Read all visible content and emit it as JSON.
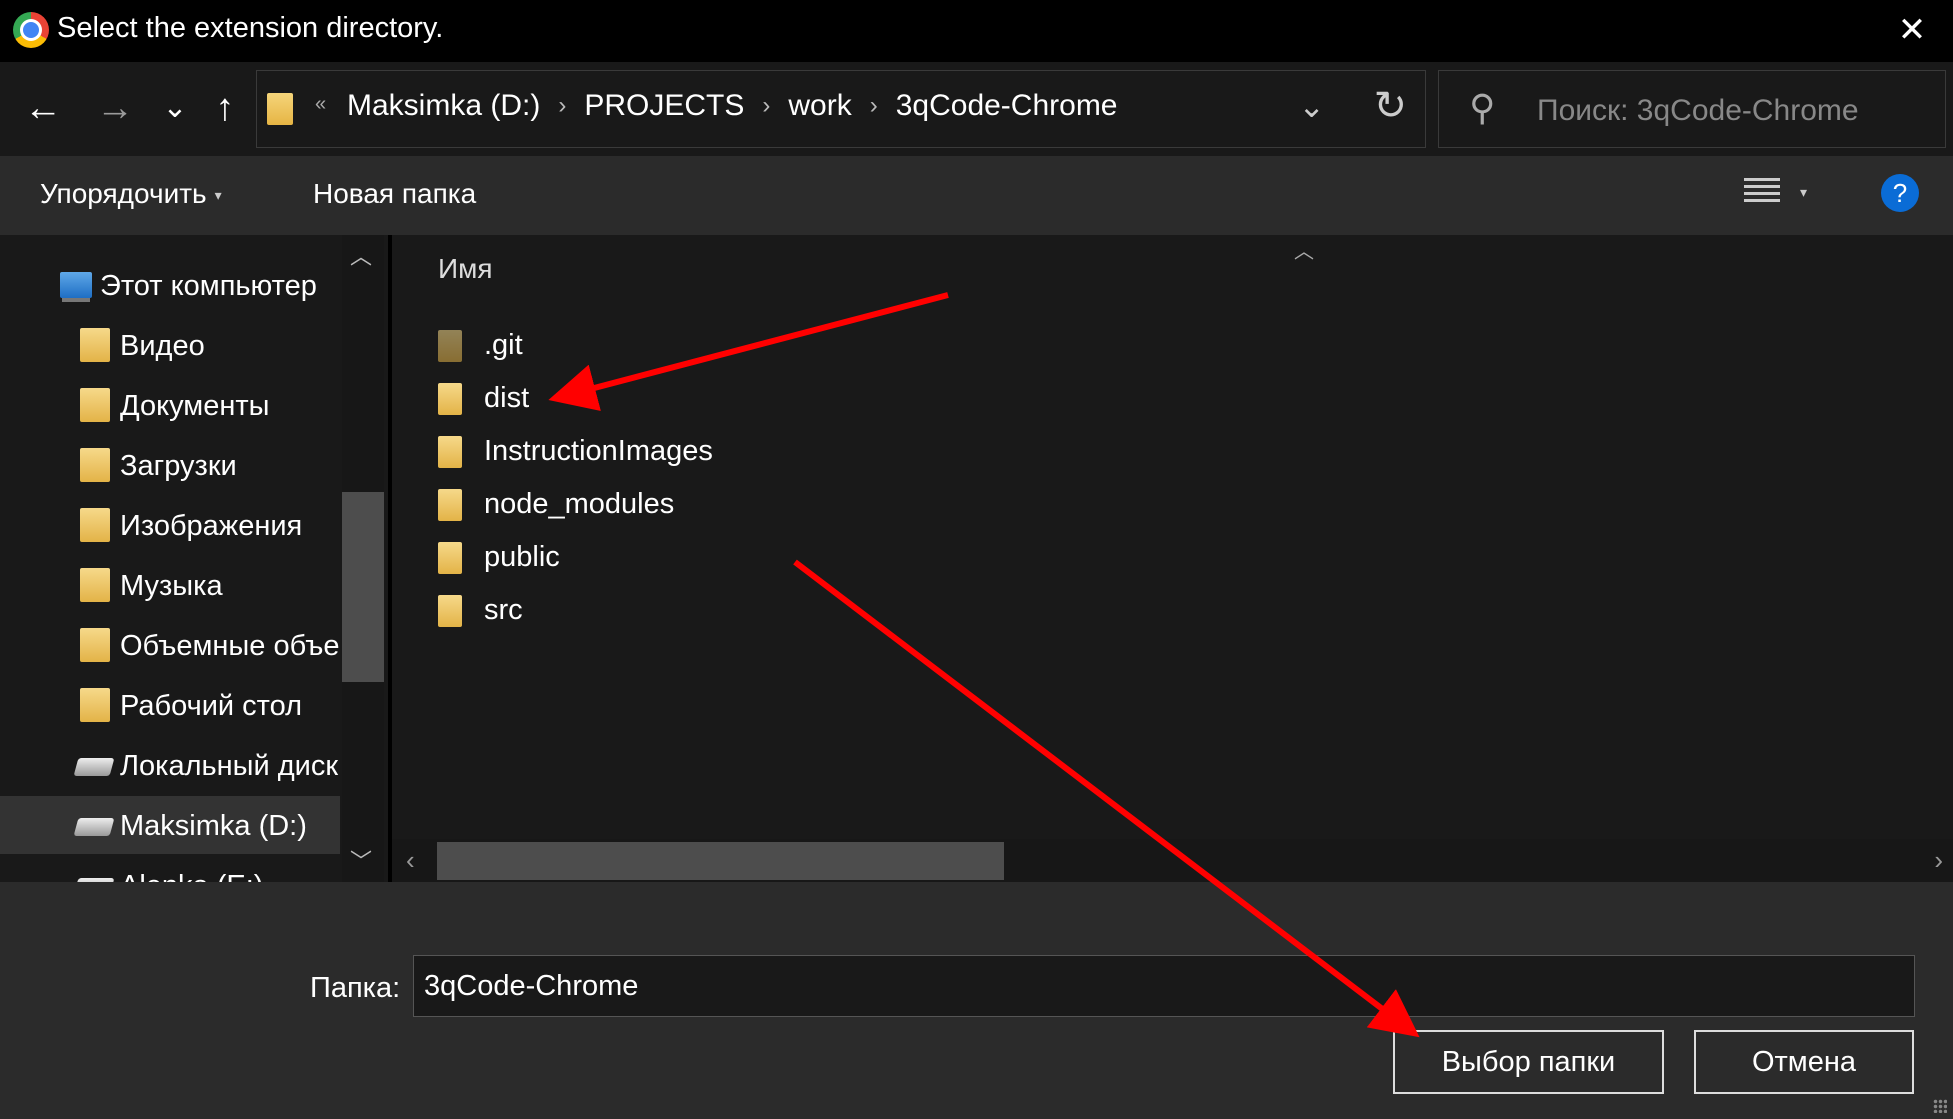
{
  "window": {
    "title": "Select the extension directory.",
    "close_icon": "close-icon"
  },
  "nav": {
    "back_icon": "←",
    "forward_icon": "→",
    "recent_icon": "⌄",
    "up_icon": "↑"
  },
  "address": {
    "overflow": "«",
    "crumbs": [
      "Maksimka (D:)",
      "PROJECTS",
      "work",
      "3qCode-Chrome"
    ],
    "separator": "›",
    "dropdown_icon": "⌄",
    "refresh_icon": "↻"
  },
  "search": {
    "placeholder": "Поиск: 3qCode-Chrome",
    "icon": "⚲"
  },
  "toolbar": {
    "organize_label": "Упорядочить",
    "new_folder_label": "Новая папка",
    "help_label": "?"
  },
  "nav_pane": {
    "items": [
      {
        "label": "Этот компьютер",
        "icon": "computer-icon"
      },
      {
        "label": "Видео",
        "icon": "video-folder-icon"
      },
      {
        "label": "Документы",
        "icon": "documents-folder-icon"
      },
      {
        "label": "Загрузки",
        "icon": "downloads-folder-icon"
      },
      {
        "label": "Изображения",
        "icon": "pictures-folder-icon"
      },
      {
        "label": "Музыка",
        "icon": "music-folder-icon"
      },
      {
        "label": "Объемные объе",
        "icon": "3d-objects-folder-icon"
      },
      {
        "label": "Рабочий стол",
        "icon": "desktop-folder-icon"
      },
      {
        "label": "Локальный диск",
        "icon": "local-disk-icon"
      },
      {
        "label": "Maksimka (D:)",
        "icon": "drive-icon",
        "selected": true
      },
      {
        "label": "Alenka (E:)",
        "icon": "drive-icon"
      }
    ]
  },
  "files": {
    "column_name": "Имя",
    "items": [
      ".git",
      "dist",
      "InstructionImages",
      "node_modules",
      "public",
      "src"
    ]
  },
  "footer": {
    "folder_label": "Папка:",
    "folder_value": "3qCode-Chrome",
    "select_button": "Выбор папки",
    "cancel_button": "Отмена"
  },
  "colors": {
    "annotation_arrow": "#ff0000",
    "accent_help": "#0a6cd6"
  }
}
